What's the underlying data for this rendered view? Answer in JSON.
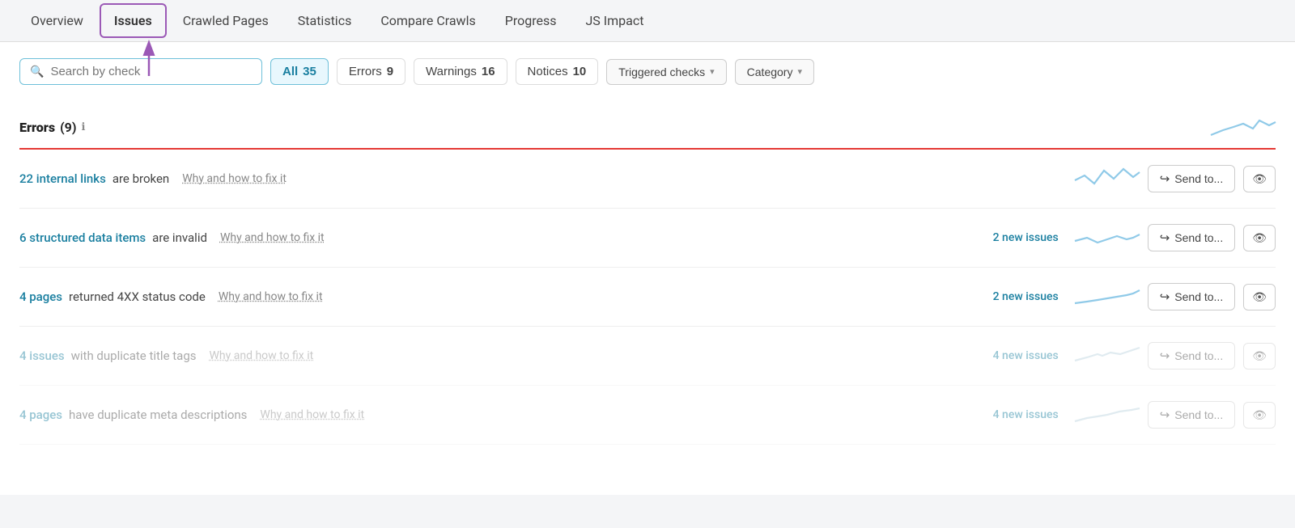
{
  "nav": {
    "items": [
      {
        "id": "overview",
        "label": "Overview",
        "active": false
      },
      {
        "id": "issues",
        "label": "Issues",
        "active": true
      },
      {
        "id": "crawled-pages",
        "label": "Crawled Pages",
        "active": false
      },
      {
        "id": "statistics",
        "label": "Statistics",
        "active": false
      },
      {
        "id": "compare-crawls",
        "label": "Compare Crawls",
        "active": false
      },
      {
        "id": "progress",
        "label": "Progress",
        "active": false
      },
      {
        "id": "js-impact",
        "label": "JS Impact",
        "active": false
      }
    ]
  },
  "filters": {
    "search_placeholder": "Search by check",
    "all_label": "All",
    "all_count": "35",
    "errors_label": "Errors",
    "errors_count": "9",
    "warnings_label": "Warnings",
    "warnings_count": "16",
    "notices_label": "Notices",
    "notices_count": "10",
    "triggered_label": "Triggered checks",
    "category_label": "Category"
  },
  "errors_section": {
    "title": "Errors",
    "count": "(9)",
    "info_icon": "ℹ"
  },
  "issues": [
    {
      "id": "broken-links",
      "link_text": "22 internal links",
      "rest_text": "are broken",
      "fix_text": "Why and how to fix it",
      "new_issues": "",
      "send_label": "Send to...",
      "faded": false
    },
    {
      "id": "structured-data",
      "link_text": "6 structured data items",
      "rest_text": "are invalid",
      "fix_text": "Why and how to fix it",
      "new_issues": "2 new issues",
      "send_label": "Send to...",
      "faded": false
    },
    {
      "id": "4xx-status",
      "link_text": "4 pages",
      "rest_text": "returned 4XX status code",
      "fix_text": "Why and how to fix it",
      "new_issues": "2 new issues",
      "send_label": "Send to...",
      "faded": false
    },
    {
      "id": "duplicate-title",
      "link_text": "4 issues",
      "rest_text": "with duplicate title tags",
      "fix_text": "Why and how to fix it",
      "new_issues": "4 new issues",
      "send_label": "Send to...",
      "faded": true
    },
    {
      "id": "duplicate-meta",
      "link_text": "4 pages",
      "rest_text": "have duplicate meta descriptions",
      "fix_text": "Why and how to fix it",
      "new_issues": "4 new issues",
      "send_label": "Send to...",
      "faded": true
    }
  ]
}
